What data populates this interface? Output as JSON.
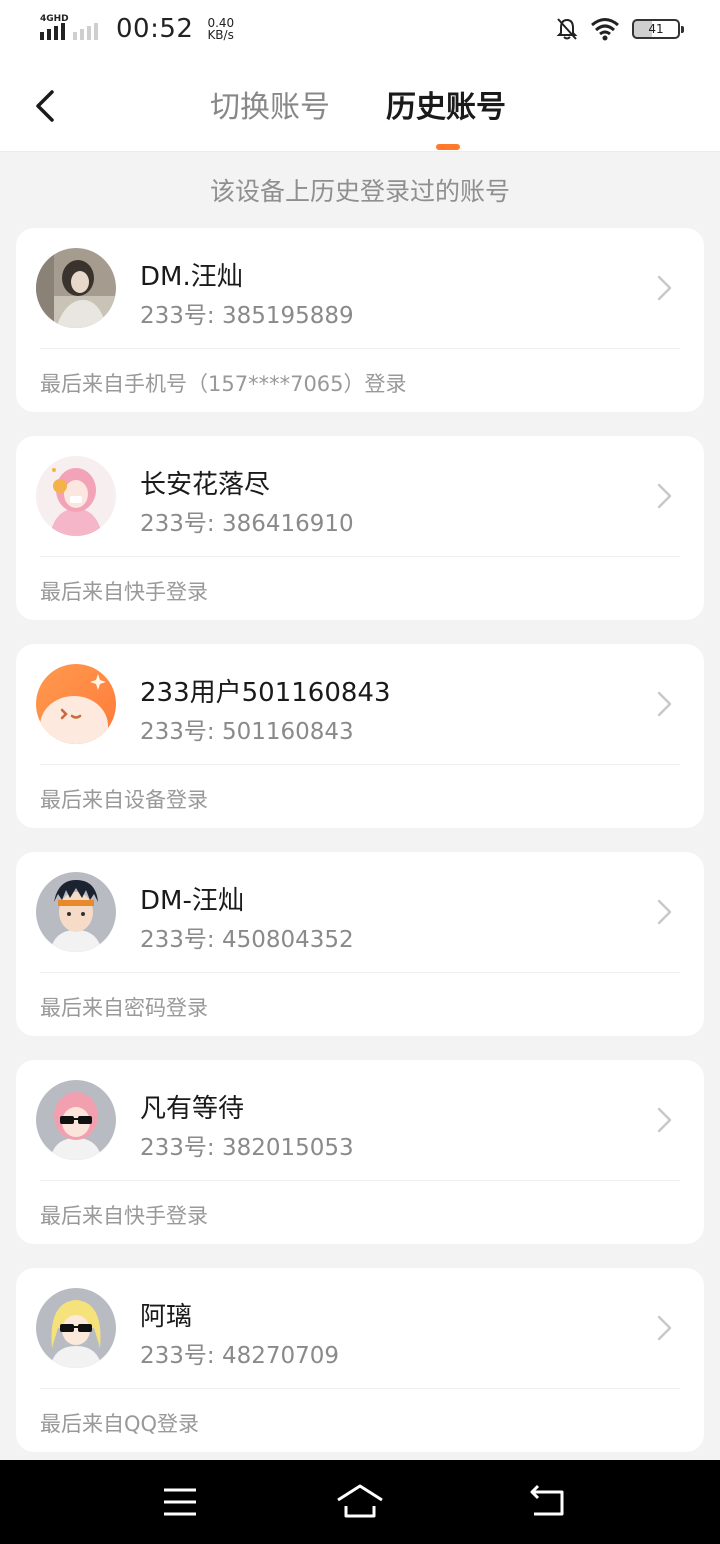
{
  "status_bar": {
    "network": "4GHD",
    "time": "00:52",
    "speed_value": "0.40",
    "speed_unit": "KB/s",
    "battery": "41"
  },
  "header": {
    "tab_switch": "切换账号",
    "tab_history": "历史账号",
    "accent_color": "#ff7a2b"
  },
  "subtitle": "该设备上历史登录过的账号",
  "accounts": [
    {
      "name": "DM.汪灿",
      "uid": "233号: 385195889",
      "source": "最后来自手机号（157****7065）登录",
      "avatar_icon": "photo-avatar"
    },
    {
      "name": "长安花落尽",
      "uid": "233号: 386416910",
      "source": "最后来自快手登录",
      "avatar_icon": "pink-anime-avatar"
    },
    {
      "name": "233用户501160843",
      "uid": "233号: 501160843",
      "source": "最后来自设备登录",
      "avatar_icon": "orange-face-avatar"
    },
    {
      "name": "DM-汪灿",
      "uid": "233号: 450804352",
      "source": "最后来自密码登录",
      "avatar_icon": "boy-headband-avatar"
    },
    {
      "name": "凡有等待",
      "uid": "233号: 382015053",
      "source": "最后来自快手登录",
      "avatar_icon": "pink-sunglasses-avatar"
    },
    {
      "name": "阿璃",
      "uid": "233号: 48270709",
      "source": "最后来自QQ登录",
      "avatar_icon": "blonde-sunglasses-avatar"
    }
  ]
}
